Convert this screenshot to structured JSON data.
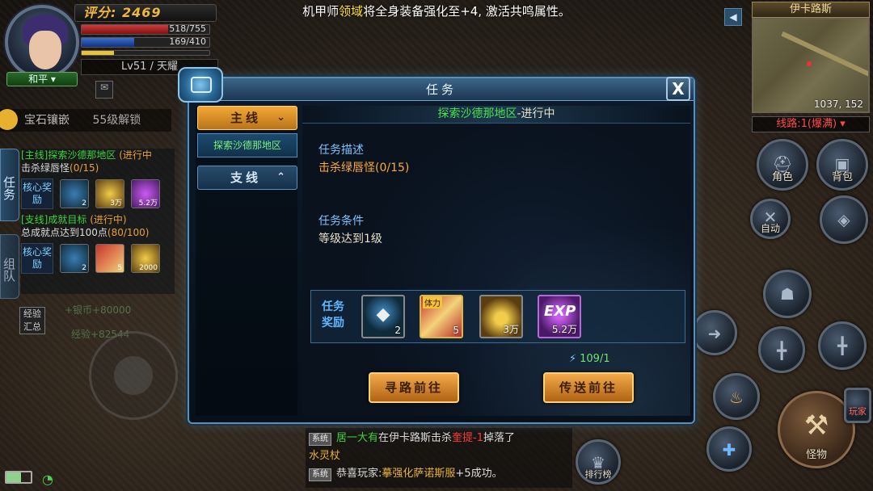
{
  "announcement": {
    "prefix": "机甲师",
    "highlight": "领域",
    "suffix": "将全身装备强化至+4, 激活共鸣属性。"
  },
  "player": {
    "score_label": "评分:",
    "score_value": "2469",
    "hp": "518/755",
    "mp": "169/410",
    "level_name": "Lv51 / 天耀",
    "mode": "和平",
    "gem_inlay": "宝石镶嵌",
    "gem_unlock": "55级解锁"
  },
  "tracker": {
    "tab_task": "任务",
    "tab_team": "组队",
    "main_line": "[主线]探索沙德那地区",
    "main_status": "(进行中",
    "main_goal": "击杀绿唇怪",
    "main_progress": "(0/15)",
    "reward_label": "核心奖励",
    "main_rewards": [
      {
        "icon": "gem-pack-icon",
        "count": "2"
      },
      {
        "icon": "gold-coins-icon",
        "count": "3万"
      },
      {
        "icon": "exp-icon",
        "count": "5.2万"
      }
    ],
    "side_line": "[支线]成就目标",
    "side_status": "(进行中)",
    "side_goal": "总成就点达到100点",
    "side_progress": "(80/100)",
    "side_rewards": [
      {
        "icon": "gem-pack-icon",
        "count": "2"
      },
      {
        "icon": "gift-pack-icon",
        "count": "5"
      },
      {
        "icon": "gold-coins-icon",
        "count": "2000"
      }
    ],
    "exp_summary": "经验汇总",
    "faint_gold": "+银币+80000",
    "faint_exp": "经验+82544"
  },
  "minimap": {
    "title": "伊卡路斯",
    "coords": "1037, 152",
    "line": "线路:1(爆满)"
  },
  "hud": {
    "role": "角色",
    "bag": "背包",
    "auto": "自动",
    "monster": "怪物",
    "rank": "排行榜",
    "player": "玩家"
  },
  "chat": {
    "tag": "系统",
    "msg1": [
      {
        "t": "居一大有",
        "c": "g"
      },
      {
        "t": "在伊卡路斯击杀",
        "c": "w"
      },
      {
        "t": "奎提-1",
        "c": "r"
      },
      {
        "t": "掉落了",
        "c": "w"
      }
    ],
    "msg1_cont": "水灵杖",
    "msg2": [
      {
        "t": "恭喜玩家:",
        "c": "w"
      },
      {
        "t": "摹强化",
        "c": "y"
      },
      {
        "t": "萨诺斯服",
        "c": "y"
      },
      {
        "t": "+5成功。",
        "c": "w"
      }
    ]
  },
  "dialog": {
    "title": "任务",
    "close": "X",
    "tab_main": "主线",
    "tab_main_chevron": "⌄",
    "quest_item": "探索沙德那地区",
    "tab_side": "支线",
    "tab_side_chevron": "⌃",
    "quest_title": "探索沙德那地区",
    "quest_state": "-进行中",
    "desc_label": "任务描述",
    "desc_text": "击杀绿唇怪",
    "desc_progress": "(0/15)",
    "cond_label": "任务条件",
    "cond_text": "等级达到1级",
    "reward_label": "任务奖励",
    "rewards": [
      {
        "icon": "gem-pack-icon",
        "count": "2"
      },
      {
        "icon": "gift-pack-icon",
        "tag": "体力",
        "count": "5"
      },
      {
        "icon": "gold-coins-icon",
        "count": "3万"
      },
      {
        "icon": "exp-icon",
        "label": "EXP",
        "count": "5.2万"
      }
    ],
    "energy": "109/1",
    "btn_path": "寻路前往",
    "btn_teleport": "传送前往"
  },
  "colors": {
    "accent_orange": "#f3a94a",
    "frame_blue": "#5c8fb3",
    "progress_green": "#4ee24e",
    "highlight_yellow": "#ffe23a"
  }
}
